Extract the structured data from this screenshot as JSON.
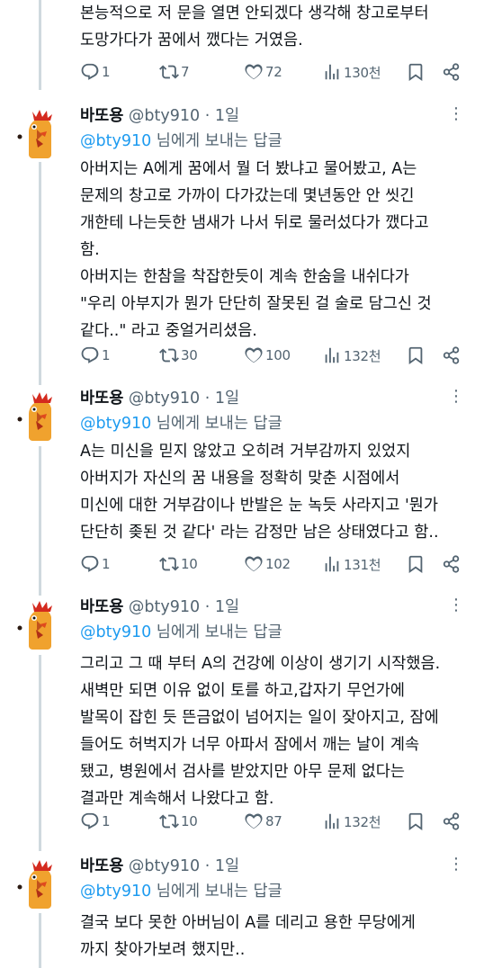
{
  "top_tweet": {
    "lines": [
      "본능적으로 저 문을 열면 안되겠다 생각해 창고로부터",
      "도망가다가 꿈에서 깼다는 거였음."
    ],
    "actions": {
      "reply": "1",
      "retweet": "7",
      "like": "72",
      "views": "130천"
    }
  },
  "tweets": [
    {
      "name": "바또용",
      "handle": "@bty910",
      "time": "· 1일",
      "reply_mention": "@bty910",
      "reply_suffix": " 님에게 보내는 답글",
      "lines": [
        "아버지는 A에게 꿈에서 뭘 더 봤냐고 물어봤고, A는",
        "문제의 창고로 가까이 다가갔는데 몇년동안 안 씻긴",
        "개한테 나는듯한 냄새가 나서 뒤로 물러섰다가 깼다고",
        "함.",
        "아버지는 한참을 착잡한듯이 계속 한숨을 내쉬다가",
        "\"우리 아부지가 뭔가 단단히 잘못된 걸 술로 담그신 것",
        "같다..\" 라고 중얼거리셨음."
      ],
      "actions": {
        "reply": "1",
        "retweet": "30",
        "like": "100",
        "views": "132천"
      }
    },
    {
      "name": "바또용",
      "handle": "@bty910",
      "time": "· 1일",
      "reply_mention": "@bty910",
      "reply_suffix": " 님에게 보내는 답글",
      "lines": [
        "A는 미신을 믿지 않았고 오히려 거부감까지 있었지",
        "아버지가 자신의 꿈 내용을 정확히 맞춘 시점에서",
        "미신에 대한 거부감이나 반발은 눈 녹듯 사라지고 '뭔가",
        "단단히 좆된 것 같다' 라는 감정만 남은 상태였다고 함.."
      ],
      "actions": {
        "reply": "1",
        "retweet": "10",
        "like": "102",
        "views": "131천"
      }
    },
    {
      "name": "바또용",
      "handle": "@bty910",
      "time": "· 1일",
      "reply_mention": "@bty910",
      "reply_suffix": " 님에게 보내는 답글",
      "lines": [
        "그리고 그 때 부터 A의 건강에 이상이 생기기 시작했음.",
        "새벽만 되면 이유 없이 토를 하고,갑자기 무언가에",
        "발목이 잡힌 듯 뜬금없이 넘어지는 일이 잦아지고, 잠에",
        "들어도 허벅지가 너무 아파서 잠에서 깨는 날이 계속",
        "됐고, 병원에서 검사를 받았지만 아무 문제 없다는",
        "결과만 계속해서 나왔다고 함."
      ],
      "actions": {
        "reply": "1",
        "retweet": "10",
        "like": "87",
        "views": "132천"
      }
    },
    {
      "name": "바또용",
      "handle": "@bty910",
      "time": "· 1일",
      "reply_mention": "@bty910",
      "reply_suffix": " 님에게 보내는 답글",
      "lines": [
        "결국 보다 못한 아버님이 A를 데리고 용한 무당에게",
        "까지 찾아가보려 했지만.."
      ],
      "actions": null
    }
  ],
  "colors": {
    "text": "#0f1419",
    "secondary": "#536471",
    "link": "#1d9bf0",
    "thread_line": "#cfd9de"
  },
  "icons": [
    "reply-icon",
    "retweet-icon",
    "like-icon",
    "views-icon",
    "bookmark-icon",
    "share-icon",
    "more-icon",
    "avatar-icon"
  ]
}
